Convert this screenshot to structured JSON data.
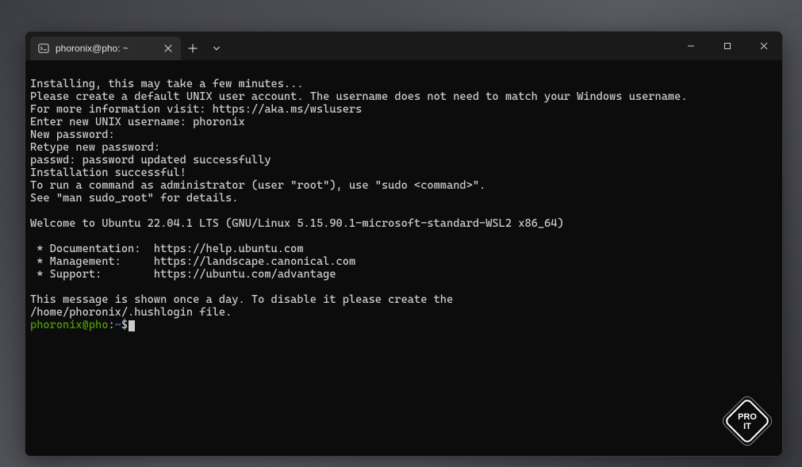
{
  "tab": {
    "title": "phoronix@pho: ~"
  },
  "terminal": {
    "lines": [
      "Installing, this may take a few minutes...",
      "Please create a default UNIX user account. The username does not need to match your Windows username.",
      "For more information visit: https://aka.ms/wslusers",
      "Enter new UNIX username: phoronix",
      "New password:",
      "Retype new password:",
      "passwd: password updated successfully",
      "Installation successful!",
      "To run a command as administrator (user \"root\"), use \"sudo <command>\".",
      "See \"man sudo_root\" for details.",
      "",
      "Welcome to Ubuntu 22.04.1 LTS (GNU/Linux 5.15.90.1-microsoft-standard-WSL2 x86_64)",
      "",
      " * Documentation:  https://help.ubuntu.com",
      " * Management:     https://landscape.canonical.com",
      " * Support:        https://ubuntu.com/advantage",
      "",
      "This message is shown once a day. To disable it please create the",
      "/home/phoronix/.hushlogin file."
    ],
    "prompt": {
      "user_host": "phoronix@pho",
      "colon": ":",
      "path": "~",
      "symbol": "$"
    }
  },
  "watermark": {
    "line1": "PRO",
    "line2": "IT"
  }
}
